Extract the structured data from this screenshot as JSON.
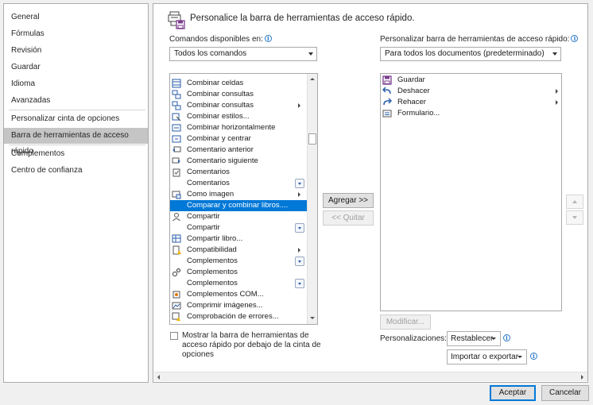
{
  "sidebar": {
    "items": [
      {
        "label": "General"
      },
      {
        "label": "Fórmulas"
      },
      {
        "label": "Revisión"
      },
      {
        "label": "Guardar"
      },
      {
        "label": "Idioma"
      },
      {
        "label": "Avanzadas"
      },
      {
        "label": "Personalizar cinta de opciones"
      },
      {
        "label": "Barra de herramientas de acceso rápido",
        "selected": true
      },
      {
        "label": "Complementos"
      },
      {
        "label": "Centro de confianza"
      }
    ]
  },
  "main": {
    "title": "Personalice la barra de herramientas de acceso rápido.",
    "left": {
      "label": "Comandos disponibles en:",
      "combo_value": "Todos los comandos",
      "commands": [
        {
          "label": "Combinar celdas",
          "icon": "merge-cells-icon"
        },
        {
          "label": "Combinar consultas",
          "icon": "merge-queries-icon"
        },
        {
          "label": "Combinar consultas",
          "icon": "merge-queries-icon",
          "submenu": true
        },
        {
          "label": "Combinar estilos...",
          "icon": "merge-styles-icon"
        },
        {
          "label": "Combinar horizontalmente",
          "icon": "merge-across-icon"
        },
        {
          "label": "Combinar y centrar",
          "icon": "merge-center-icon"
        },
        {
          "label": "Comentario anterior",
          "icon": "previous-comment-icon"
        },
        {
          "label": "Comentario siguiente",
          "icon": "next-comment-icon"
        },
        {
          "label": "Comentarios",
          "icon": "comments-icon"
        },
        {
          "label": "Comentarios",
          "icon": "",
          "dropdown": true
        },
        {
          "label": "Como imagen",
          "icon": "as-picture-icon",
          "submenu": true
        },
        {
          "label": "Comparar y combinar libros....",
          "icon": "",
          "selected": true
        },
        {
          "label": "Compartir",
          "icon": "share-icon"
        },
        {
          "label": "Compartir",
          "icon": "",
          "dropdown": true
        },
        {
          "label": "Compartir libro...",
          "icon": "share-workbook-icon"
        },
        {
          "label": "Compatibilidad",
          "icon": "compatibility-icon",
          "submenu": true
        },
        {
          "label": "Complementos",
          "icon": "",
          "dropdown": true
        },
        {
          "label": "Complementos",
          "icon": "addins-icon"
        },
        {
          "label": "Complementos",
          "icon": "",
          "dropdown": true
        },
        {
          "label": "Complementos COM...",
          "icon": "com-addins-icon"
        },
        {
          "label": "Comprimir imágenes...",
          "icon": "compress-pictures-icon"
        },
        {
          "label": "Comprobación de errores...",
          "icon": "error-checking-icon"
        }
      ],
      "checkbox_label_lines": [
        "Mostrar la barra de herramientas de",
        "acceso rápido por debajo de la cinta de",
        "opciones"
      ]
    },
    "middle": {
      "add_label": "Agregar >>",
      "remove_label": "<< Quitar"
    },
    "right": {
      "label": "Personalizar barra de herramientas de acceso rápido:",
      "combo_value": "Para todos los documentos (predeterminado)",
      "items": [
        {
          "label": "Guardar",
          "icon": "save-icon"
        },
        {
          "label": "Deshacer",
          "icon": "undo-icon",
          "submenu": true
        },
        {
          "label": "Rehacer",
          "icon": "redo-icon",
          "submenu": true
        },
        {
          "label": "Formulario...",
          "icon": "form-icon"
        }
      ],
      "modify_label": "Modificar...",
      "personalizations_label": "Personalizaciones:",
      "reset_label": "Restablecer",
      "import_export_label": "Importar o exportar"
    }
  },
  "footer": {
    "ok_label": "Aceptar",
    "cancel_label": "Cancelar"
  },
  "colors": {
    "selection": "#0078d7",
    "sidebar_selected": "#c5c5c5",
    "info_blue": "#2b78c5"
  }
}
